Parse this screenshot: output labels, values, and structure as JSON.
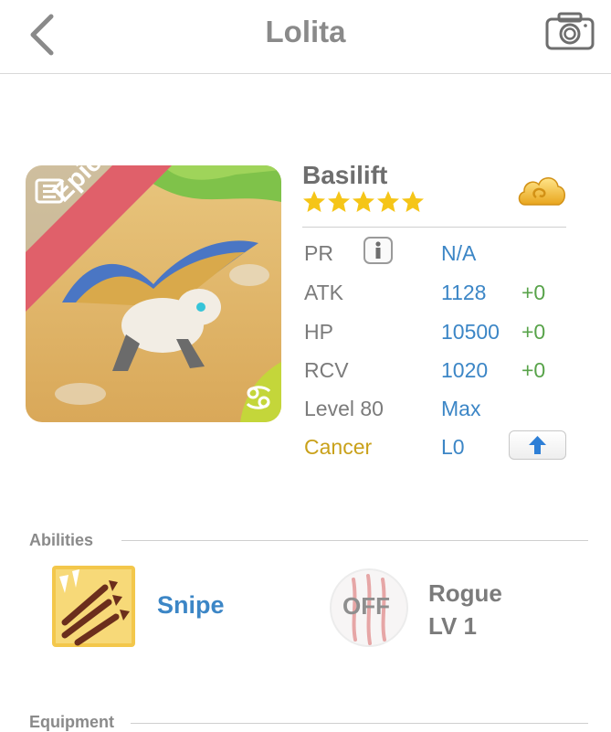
{
  "header": {
    "title": "Lolita",
    "back_icon": "chevron-left-icon",
    "camera_icon": "camera-icon"
  },
  "monster": {
    "name": "Basilift",
    "rarity": "Epic",
    "stars": 5,
    "element_icon": "cancer-zodiac-icon",
    "currency_icon": "golden-cloud-icon"
  },
  "stats": {
    "pr": {
      "label": "PR",
      "value": "N/A"
    },
    "atk": {
      "label": "ATK",
      "value": "1128",
      "bonus": "+0"
    },
    "hp": {
      "label": "HP",
      "value": "10500",
      "bonus": "+0"
    },
    "rcv": {
      "label": "RCV",
      "value": "1020",
      "bonus": "+0"
    },
    "level": {
      "label": "Level 80",
      "value": "Max"
    },
    "sign": {
      "label": "Cancer",
      "value": "L0"
    }
  },
  "abilities": {
    "title": "Abilities",
    "active": {
      "name": "Snipe",
      "icon": "triple-arrow-icon"
    },
    "passive": {
      "status": "OFF",
      "name": "Rogue",
      "level": "LV 1",
      "icon": "claw-scratch-icon"
    }
  },
  "equipment": {
    "title": "Equipment"
  },
  "colors": {
    "accent_blue": "#3c86c6",
    "bonus_green": "#58a34a",
    "cancer_gold": "#c9a11a",
    "epic_ribbon": "#e0606a",
    "star_gold": "#f5c518"
  }
}
